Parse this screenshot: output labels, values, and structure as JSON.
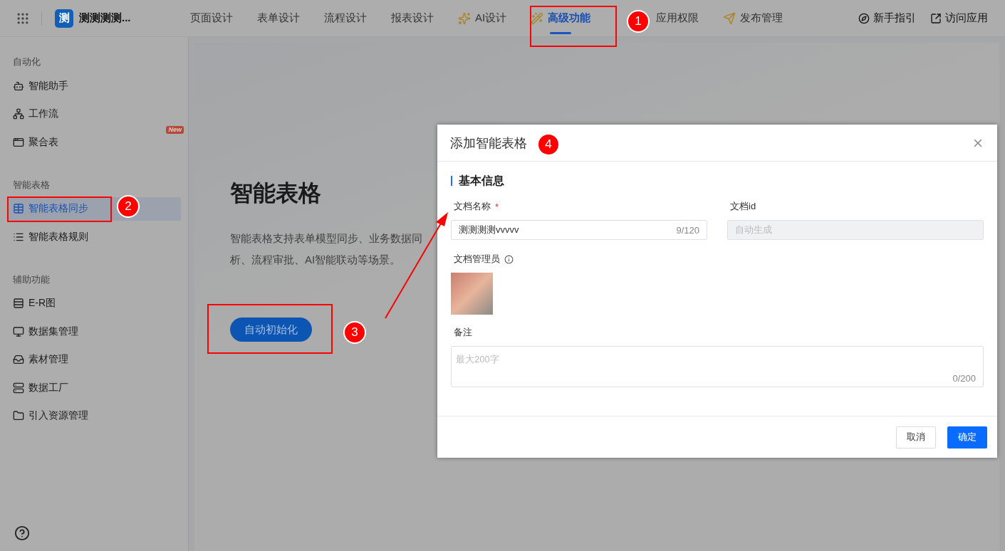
{
  "app": {
    "logo": "测",
    "name": "测测测测..."
  },
  "nav_tabs": [
    {
      "label": "页面设计",
      "selected": false
    },
    {
      "label": "表单设计",
      "selected": false
    },
    {
      "label": "流程设计",
      "selected": false
    },
    {
      "label": "报表设计",
      "selected": false
    },
    {
      "label": "AI设计",
      "selected": false
    },
    {
      "label": "高级功能",
      "selected": true
    },
    {
      "label": "应用权限",
      "selected": false
    },
    {
      "label": "发布管理",
      "selected": false
    }
  ],
  "header_actions": [
    {
      "label": "新手指引"
    },
    {
      "label": "访问应用"
    }
  ],
  "sidebar": [
    {
      "title": "自动化",
      "items": [
        {
          "label": "智能助手",
          "selected": false
        },
        {
          "label": "工作流",
          "selected": false
        },
        {
          "label": "聚合表",
          "selected": false,
          "badge": "New"
        }
      ]
    },
    {
      "title": "智能表格",
      "items": [
        {
          "label": "智能表格同步",
          "selected": true
        },
        {
          "label": "智能表格规则",
          "selected": false
        }
      ]
    },
    {
      "title": "辅助功能",
      "items": [
        {
          "label": "E-R图",
          "selected": false
        },
        {
          "label": "数据集管理",
          "selected": false
        },
        {
          "label": "素材管理",
          "selected": false
        },
        {
          "label": "数据工厂",
          "selected": false
        },
        {
          "label": "引入资源管理",
          "selected": false
        }
      ]
    }
  ],
  "hero": {
    "title": "智能表格",
    "description_lines": [
      "智能表格支持表单模型同步、业务数据同",
      "析、流程审批、AI智能联动等场景。"
    ],
    "button": "自动初始化"
  },
  "dialog": {
    "title": "添加智能表格",
    "section_title": "基本信息",
    "name_field": {
      "label": "文档名称",
      "required_mark": "*",
      "value": "测测测测vvvvv",
      "counter": "9/120"
    },
    "id_field": {
      "label": "文档id",
      "placeholder": "自动生成",
      "disabled": true
    },
    "admin": {
      "label": "文档管理员"
    },
    "notes": {
      "label": "备注",
      "placeholder": "最大200字",
      "counter": "0/200"
    },
    "buttons": [
      {
        "label": "取消",
        "kind": "default"
      },
      {
        "label": "确定",
        "kind": "primary"
      }
    ]
  },
  "annotations": [
    {
      "number": "1"
    },
    {
      "number": "2"
    },
    {
      "number": "3"
    },
    {
      "number": "4"
    }
  ]
}
